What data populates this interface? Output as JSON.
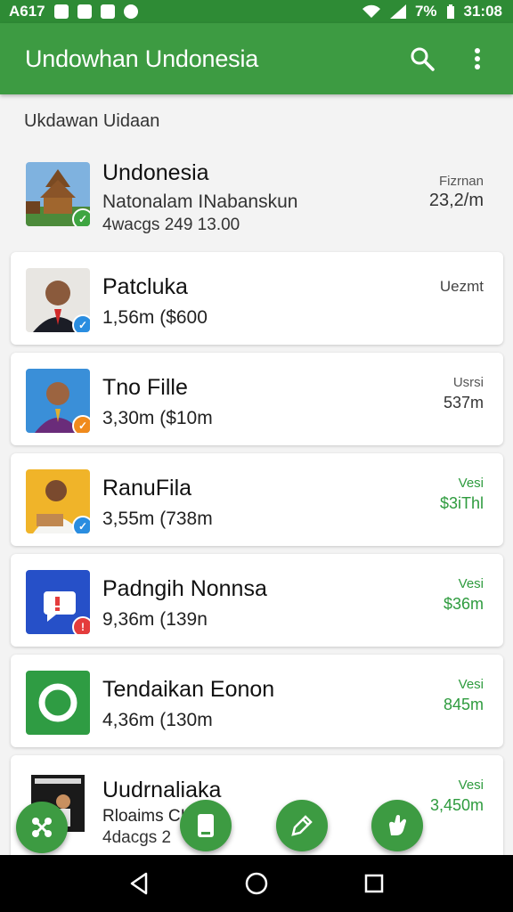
{
  "status_bar": {
    "left": "A617",
    "battery": "7%",
    "time": "31:08"
  },
  "app_bar": {
    "title": "Undowhan Undonesia",
    "search_icon": "search-icon",
    "menu_icon": "more-vert-icon"
  },
  "section_title": "Ukdawan Uidaan",
  "items": [
    {
      "title": "Undonesia",
      "subtitle": "Natonalam INabanskun",
      "line2": "4wacgs 249 13.00",
      "meta_top": "Fizrnan",
      "meta_value": "23,2/m",
      "badge_color": "#3ea541"
    },
    {
      "title": "Patcluka",
      "subtitle": "1,56m ($600",
      "meta_label": "Uezmt",
      "badge_color": "#2a8de0"
    },
    {
      "title": "Tno Fille",
      "subtitle": "3,30m ($10m",
      "meta_top": "Usrsi",
      "meta_value": "537m",
      "badge_color": "#f08a1c"
    },
    {
      "title": "RanuFila",
      "subtitle": "3,55m (738m",
      "meta_top": "Vesi",
      "meta_value": "$3iThl",
      "badge_color": "#2a8de0"
    },
    {
      "title": "Padngih Nonnsa",
      "subtitle": "9,36m (139n",
      "meta_top": "Vesi",
      "meta_value": "$36m",
      "badge_color": "#e43c3c"
    },
    {
      "title": "Tendaikan Eonon",
      "subtitle": "4,36m (130m",
      "meta_top": "Vesi",
      "meta_value": "845m",
      "badge_color": "#3ea541"
    },
    {
      "title": "Uudrnaliaka",
      "subtitle": "Rloaims CI",
      "line2": "4dacgs 2",
      "meta_top": "Vesi",
      "meta_value": "3,450m",
      "badge_color": "#3ea541"
    }
  ],
  "fabs": [
    "network-icon",
    "document-icon",
    "edit-icon",
    "hand-icon"
  ],
  "nav": [
    "back-icon",
    "home-icon",
    "recents-icon"
  ],
  "colors": {
    "primary": "#3d9b42",
    "status": "#2e8b35",
    "accent_green": "#2e9b3e"
  }
}
